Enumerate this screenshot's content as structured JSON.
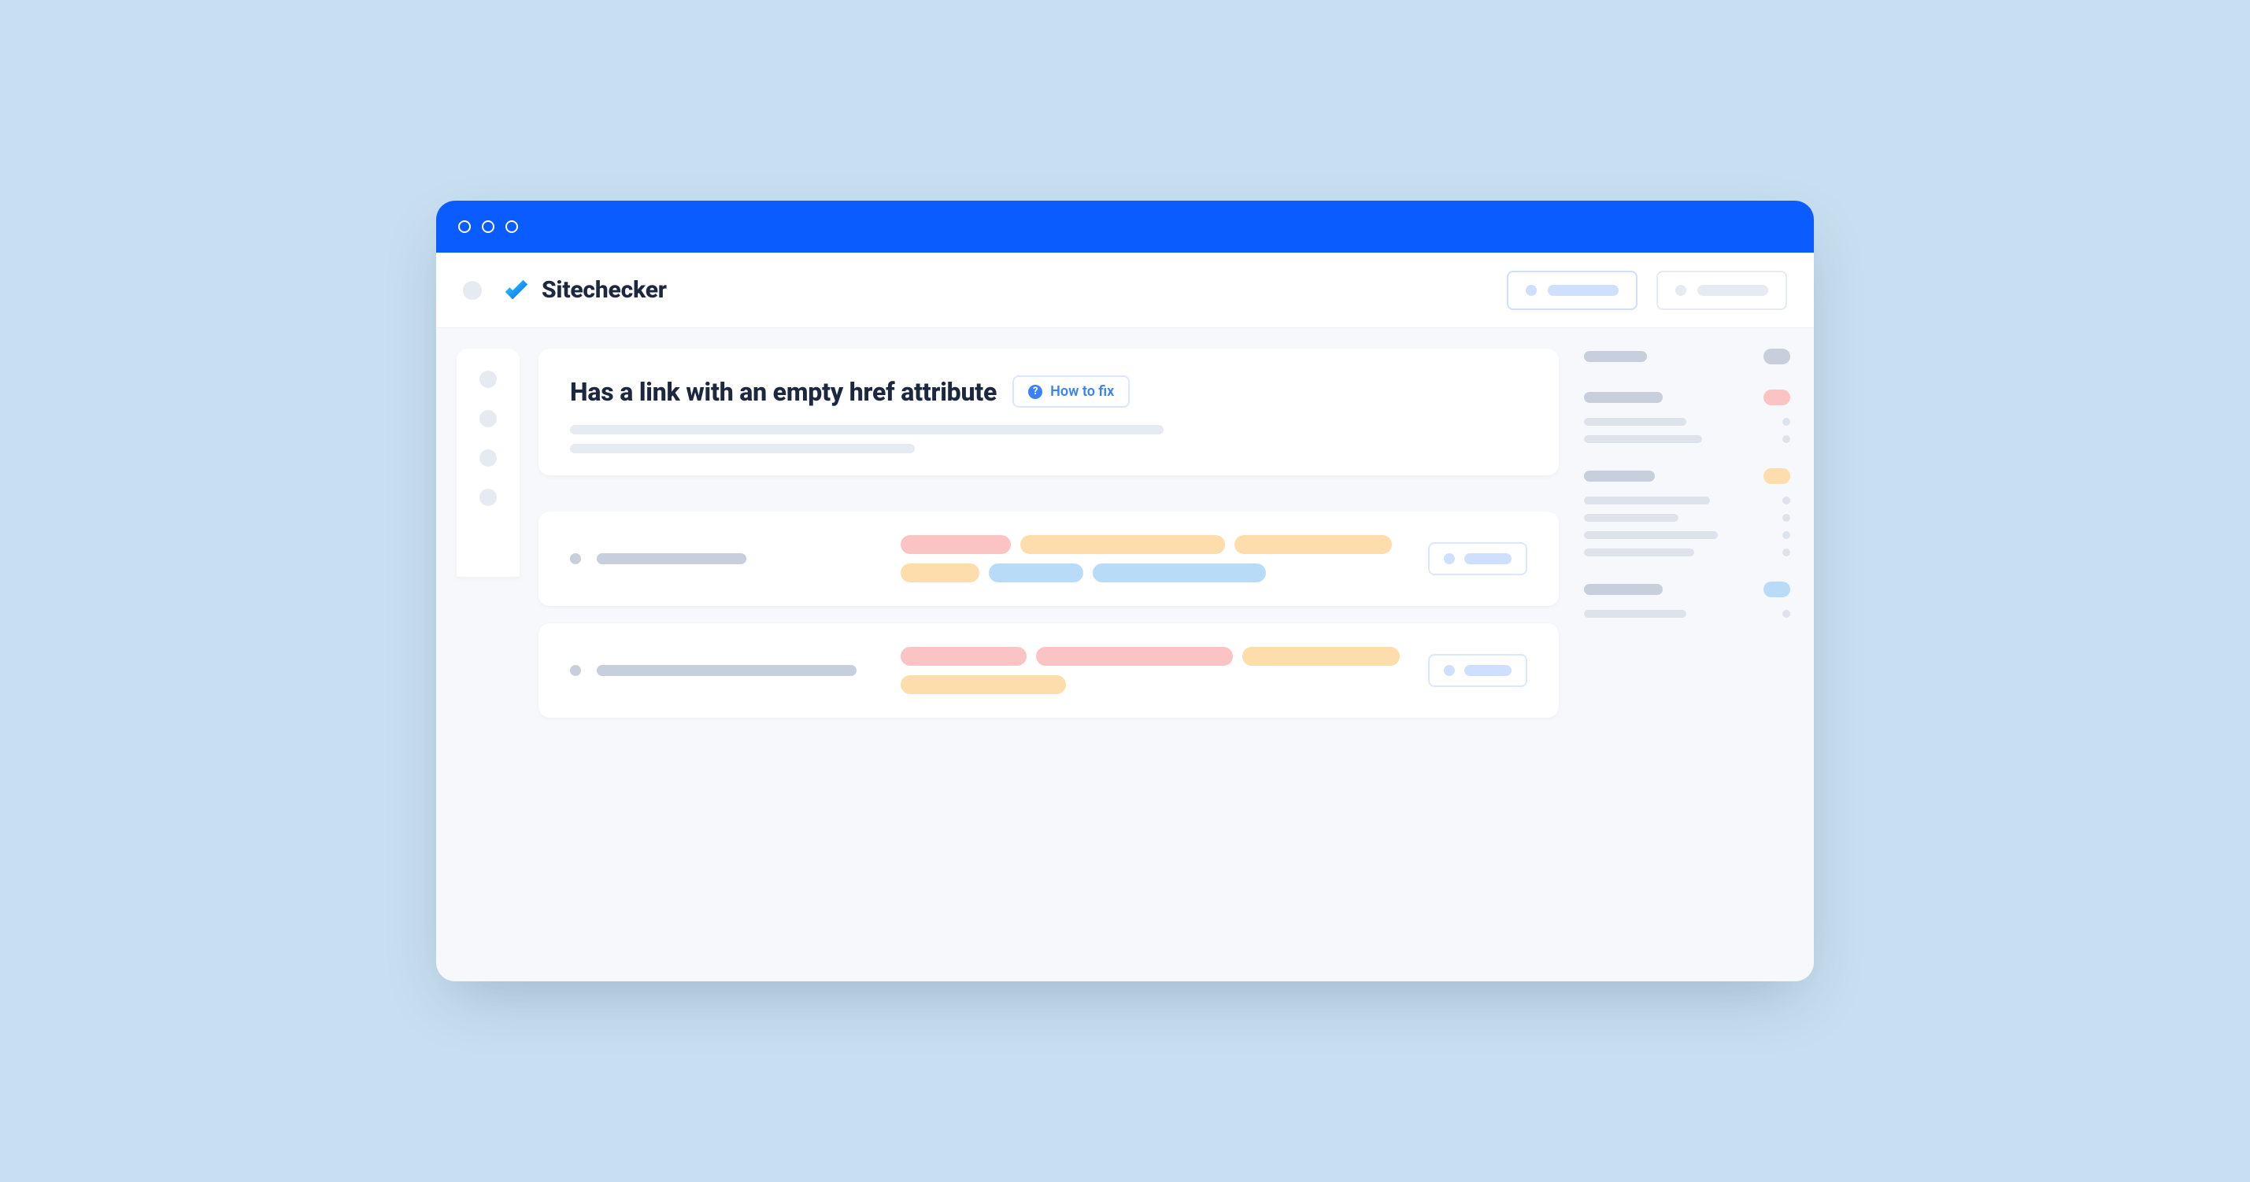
{
  "app": {
    "name": "Sitechecker"
  },
  "issue": {
    "title": "Has a link with an empty href attribute",
    "how_to_fix_label": "How to fix"
  }
}
